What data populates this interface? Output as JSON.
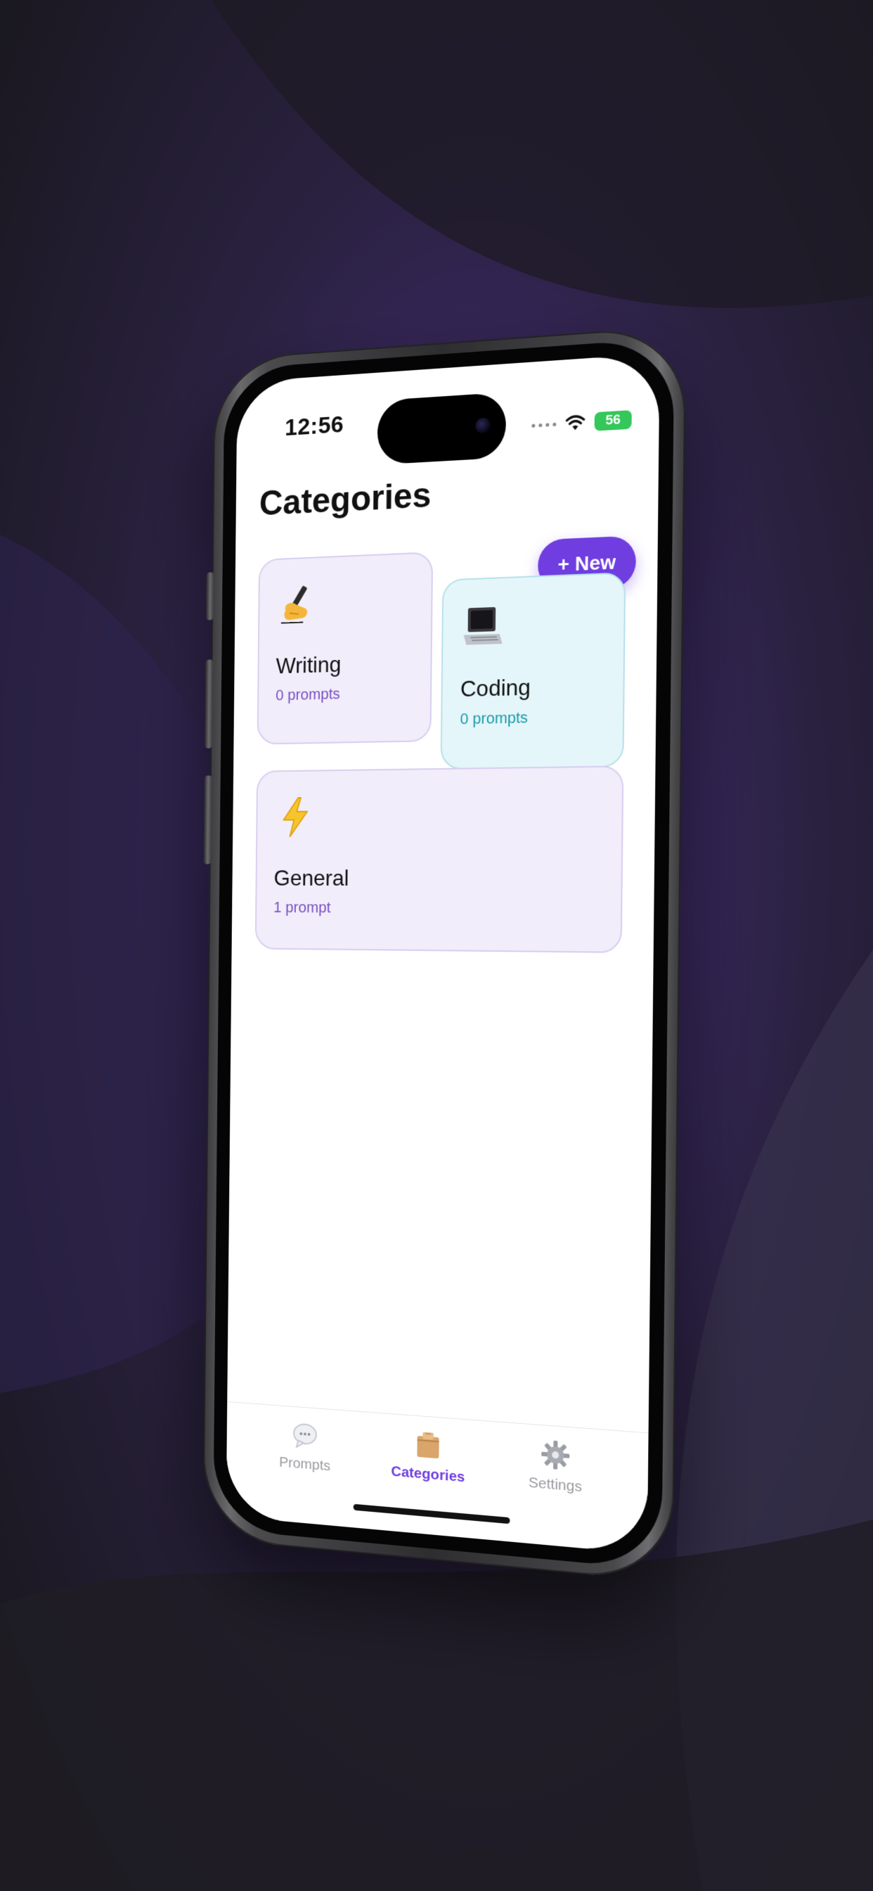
{
  "status_bar": {
    "time": "12:56",
    "battery": "56"
  },
  "header": {
    "title": "Categories",
    "new_button_label": "+ New"
  },
  "categories": [
    {
      "name": "Writing",
      "count": "0 prompts",
      "icon": "writing-hand-icon"
    },
    {
      "name": "Coding",
      "count": "0 prompts",
      "icon": "laptop-icon"
    },
    {
      "name": "General",
      "count": "1 prompt",
      "icon": "lightning-icon"
    }
  ],
  "tab_bar": {
    "active": "Categories",
    "tabs": [
      {
        "label": "Prompts",
        "icon": "speech-bubble-icon"
      },
      {
        "label": "Categories",
        "icon": "folder-icon"
      },
      {
        "label": "Settings",
        "icon": "gear-icon"
      }
    ]
  },
  "colors": {
    "accent": "#6f3de0",
    "writing_card_bg": "#f1edfa",
    "coding_card_bg": "#e4f6fa",
    "battery": "#34c759"
  }
}
